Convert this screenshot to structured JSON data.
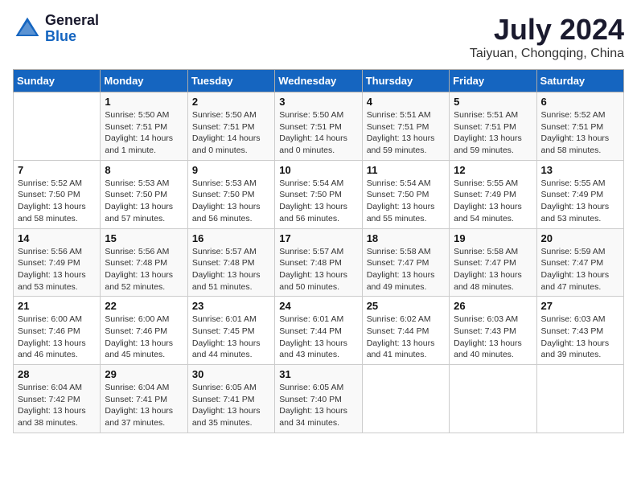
{
  "header": {
    "logo_general": "General",
    "logo_blue": "Blue",
    "month_title": "July 2024",
    "location": "Taiyuan, Chongqing, China"
  },
  "days_of_week": [
    "Sunday",
    "Monday",
    "Tuesday",
    "Wednesday",
    "Thursday",
    "Friday",
    "Saturday"
  ],
  "weeks": [
    [
      {
        "day": "",
        "info": ""
      },
      {
        "day": "1",
        "info": "Sunrise: 5:50 AM\nSunset: 7:51 PM\nDaylight: 14 hours\nand 1 minute."
      },
      {
        "day": "2",
        "info": "Sunrise: 5:50 AM\nSunset: 7:51 PM\nDaylight: 14 hours\nand 0 minutes."
      },
      {
        "day": "3",
        "info": "Sunrise: 5:50 AM\nSunset: 7:51 PM\nDaylight: 14 hours\nand 0 minutes."
      },
      {
        "day": "4",
        "info": "Sunrise: 5:51 AM\nSunset: 7:51 PM\nDaylight: 13 hours\nand 59 minutes."
      },
      {
        "day": "5",
        "info": "Sunrise: 5:51 AM\nSunset: 7:51 PM\nDaylight: 13 hours\nand 59 minutes."
      },
      {
        "day": "6",
        "info": "Sunrise: 5:52 AM\nSunset: 7:51 PM\nDaylight: 13 hours\nand 58 minutes."
      }
    ],
    [
      {
        "day": "7",
        "info": "Sunrise: 5:52 AM\nSunset: 7:50 PM\nDaylight: 13 hours\nand 58 minutes."
      },
      {
        "day": "8",
        "info": "Sunrise: 5:53 AM\nSunset: 7:50 PM\nDaylight: 13 hours\nand 57 minutes."
      },
      {
        "day": "9",
        "info": "Sunrise: 5:53 AM\nSunset: 7:50 PM\nDaylight: 13 hours\nand 56 minutes."
      },
      {
        "day": "10",
        "info": "Sunrise: 5:54 AM\nSunset: 7:50 PM\nDaylight: 13 hours\nand 56 minutes."
      },
      {
        "day": "11",
        "info": "Sunrise: 5:54 AM\nSunset: 7:50 PM\nDaylight: 13 hours\nand 55 minutes."
      },
      {
        "day": "12",
        "info": "Sunrise: 5:55 AM\nSunset: 7:49 PM\nDaylight: 13 hours\nand 54 minutes."
      },
      {
        "day": "13",
        "info": "Sunrise: 5:55 AM\nSunset: 7:49 PM\nDaylight: 13 hours\nand 53 minutes."
      }
    ],
    [
      {
        "day": "14",
        "info": "Sunrise: 5:56 AM\nSunset: 7:49 PM\nDaylight: 13 hours\nand 53 minutes."
      },
      {
        "day": "15",
        "info": "Sunrise: 5:56 AM\nSunset: 7:48 PM\nDaylight: 13 hours\nand 52 minutes."
      },
      {
        "day": "16",
        "info": "Sunrise: 5:57 AM\nSunset: 7:48 PM\nDaylight: 13 hours\nand 51 minutes."
      },
      {
        "day": "17",
        "info": "Sunrise: 5:57 AM\nSunset: 7:48 PM\nDaylight: 13 hours\nand 50 minutes."
      },
      {
        "day": "18",
        "info": "Sunrise: 5:58 AM\nSunset: 7:47 PM\nDaylight: 13 hours\nand 49 minutes."
      },
      {
        "day": "19",
        "info": "Sunrise: 5:58 AM\nSunset: 7:47 PM\nDaylight: 13 hours\nand 48 minutes."
      },
      {
        "day": "20",
        "info": "Sunrise: 5:59 AM\nSunset: 7:47 PM\nDaylight: 13 hours\nand 47 minutes."
      }
    ],
    [
      {
        "day": "21",
        "info": "Sunrise: 6:00 AM\nSunset: 7:46 PM\nDaylight: 13 hours\nand 46 minutes."
      },
      {
        "day": "22",
        "info": "Sunrise: 6:00 AM\nSunset: 7:46 PM\nDaylight: 13 hours\nand 45 minutes."
      },
      {
        "day": "23",
        "info": "Sunrise: 6:01 AM\nSunset: 7:45 PM\nDaylight: 13 hours\nand 44 minutes."
      },
      {
        "day": "24",
        "info": "Sunrise: 6:01 AM\nSunset: 7:44 PM\nDaylight: 13 hours\nand 43 minutes."
      },
      {
        "day": "25",
        "info": "Sunrise: 6:02 AM\nSunset: 7:44 PM\nDaylight: 13 hours\nand 41 minutes."
      },
      {
        "day": "26",
        "info": "Sunrise: 6:03 AM\nSunset: 7:43 PM\nDaylight: 13 hours\nand 40 minutes."
      },
      {
        "day": "27",
        "info": "Sunrise: 6:03 AM\nSunset: 7:43 PM\nDaylight: 13 hours\nand 39 minutes."
      }
    ],
    [
      {
        "day": "28",
        "info": "Sunrise: 6:04 AM\nSunset: 7:42 PM\nDaylight: 13 hours\nand 38 minutes."
      },
      {
        "day": "29",
        "info": "Sunrise: 6:04 AM\nSunset: 7:41 PM\nDaylight: 13 hours\nand 37 minutes."
      },
      {
        "day": "30",
        "info": "Sunrise: 6:05 AM\nSunset: 7:41 PM\nDaylight: 13 hours\nand 35 minutes."
      },
      {
        "day": "31",
        "info": "Sunrise: 6:05 AM\nSunset: 7:40 PM\nDaylight: 13 hours\nand 34 minutes."
      },
      {
        "day": "",
        "info": ""
      },
      {
        "day": "",
        "info": ""
      },
      {
        "day": "",
        "info": ""
      }
    ]
  ]
}
